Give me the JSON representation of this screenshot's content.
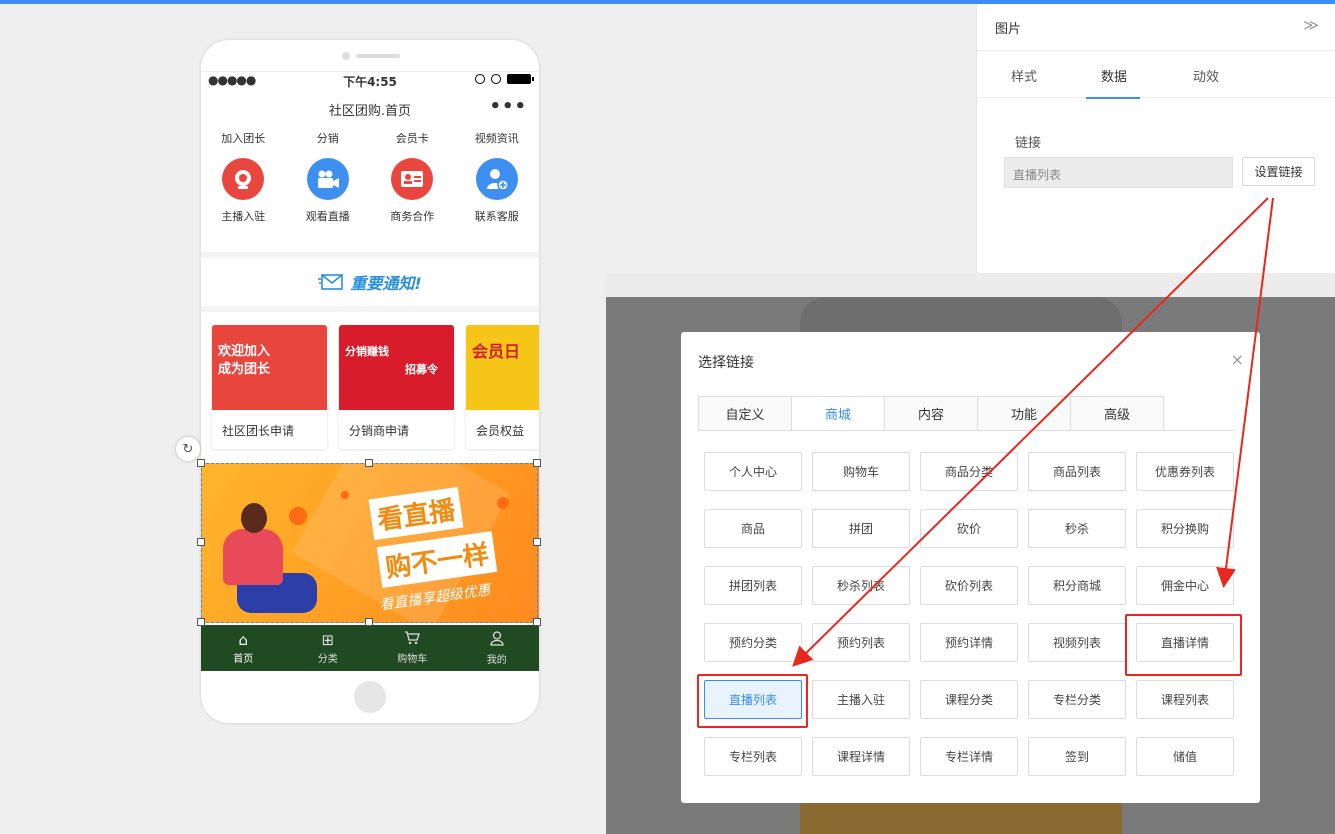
{
  "phone": {
    "status_dots": "●●●●●",
    "status_time": "下午4:55",
    "nav_title": "社区团购.首页",
    "nav_more": "•••",
    "top_links": [
      "加入团长",
      "分销",
      "会员卡",
      "视频资讯"
    ],
    "icons": [
      {
        "label": "主播入驻",
        "icon": "webcam-icon"
      },
      {
        "label": "观看直播",
        "icon": "video-camera-icon"
      },
      {
        "label": "商务合作",
        "icon": "id-card-icon"
      },
      {
        "label": "联系客服",
        "icon": "user-add-icon"
      }
    ],
    "notice": "重要通知!",
    "cards": [
      {
        "caption": "社区团长申请",
        "img_line1": "欢迎加入",
        "img_line2": "成为团长",
        "color": "#e8453c"
      },
      {
        "caption": "分销商申请",
        "img_line1": "分销赚钱",
        "img_line2": "招募令",
        "color": "#d81c2b"
      },
      {
        "caption": "会员权益",
        "img_line1": "会员日",
        "img_line2": "",
        "color": "#f5c518"
      }
    ],
    "banner": {
      "line1": "看直播",
      "line2": "购不一样",
      "line3": "看直播享超级优惠"
    },
    "tabbar": [
      {
        "label": "首页",
        "glyph": "⌂",
        "icon": "home-icon"
      },
      {
        "label": "分类",
        "glyph": "⊞",
        "icon": "grid-icon"
      },
      {
        "label": "购物车",
        "glyph": "🛒",
        "icon": "cart-icon"
      },
      {
        "label": "我的",
        "glyph": "☺",
        "icon": "user-icon"
      }
    ],
    "tabbar_color": "#1f4a22",
    "rotate_glyph": "↻"
  },
  "panel": {
    "title": "图片",
    "collapse_glyph": "≫",
    "tabs": [
      "样式",
      "数据",
      "动效"
    ],
    "active_tab": "数据",
    "link_label": "链接",
    "link_value": "直播列表",
    "set_link_button": "设置链接"
  },
  "modal": {
    "title": "选择链接",
    "close_glyph": "×",
    "tabs": [
      "自定义",
      "商城",
      "内容",
      "功能",
      "高级"
    ],
    "active_tab": "商城",
    "options": [
      "个人中心",
      "购物车",
      "商品分类",
      "商品列表",
      "优惠券列表",
      "商品",
      "拼团",
      "砍价",
      "秒杀",
      "积分换购",
      "拼团列表",
      "秒杀列表",
      "砍价列表",
      "积分商城",
      "佣金中心",
      "预约分类",
      "预约列表",
      "预约详情",
      "视频列表",
      "直播详情",
      "直播列表",
      "主播入驻",
      "课程分类",
      "专栏分类",
      "课程列表",
      "专栏列表",
      "课程详情",
      "专栏详情",
      "签到",
      "储值"
    ],
    "selected_option": "直播列表",
    "highlighted_option": "直播详情"
  },
  "colors": {
    "accent": "#3b8cf5",
    "annotation_red": "#e8271f"
  }
}
